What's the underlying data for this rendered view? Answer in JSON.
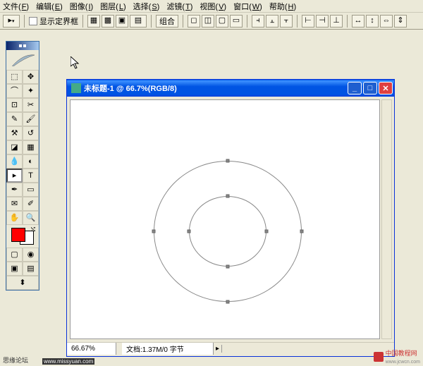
{
  "menu": {
    "items": [
      {
        "label": "文件",
        "hotkey": "F"
      },
      {
        "label": "编辑",
        "hotkey": "E"
      },
      {
        "label": "图像",
        "hotkey": "I"
      },
      {
        "label": "图层",
        "hotkey": "L"
      },
      {
        "label": "选择",
        "hotkey": "S"
      },
      {
        "label": "滤镜",
        "hotkey": "T"
      },
      {
        "label": "视图",
        "hotkey": "V"
      },
      {
        "label": "窗口",
        "hotkey": "W"
      },
      {
        "label": "帮助",
        "hotkey": "H"
      }
    ]
  },
  "options": {
    "show_bounding": "显示定界框",
    "combine": "组合"
  },
  "toolbox": {
    "fg_color": "#ff0000",
    "bg_color": "#ffffff",
    "tools": [
      "marquee",
      "move",
      "lasso",
      "wand",
      "crop",
      "slice",
      "healing",
      "brush",
      "stamp",
      "history",
      "eraser",
      "gradient",
      "blur",
      "dodge",
      "path",
      "type",
      "pen",
      "shape",
      "notes",
      "eyedropper",
      "hand",
      "zoom"
    ]
  },
  "document": {
    "title": "未标题-1 @ 66.7%(RGB/8)",
    "zoom": "66.67%",
    "docinfo": "文档:1.37M/0 字节"
  },
  "watermarks": {
    "left": "思缘论坛",
    "url": "www.missyuan.com",
    "right": "中国教程网",
    "right_url": "www.jcwcn.com"
  }
}
